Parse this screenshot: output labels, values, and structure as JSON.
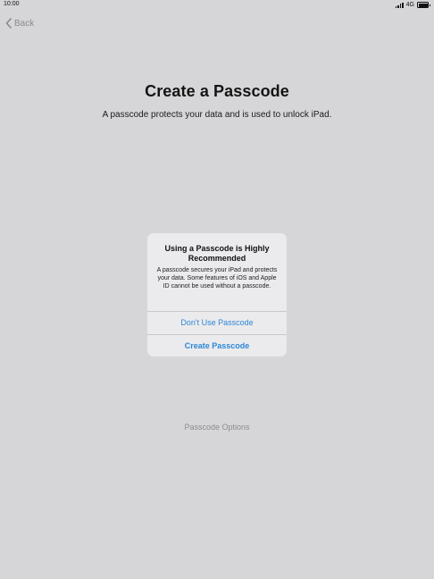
{
  "status_bar": {
    "time": "10:00",
    "network": "4G",
    "icons": [
      "signal-icon",
      "battery-icon"
    ]
  },
  "nav": {
    "back_label": "Back",
    "back_icon": "chevron-left-icon"
  },
  "header": {
    "title": "Create a Passcode",
    "subtitle": "A passcode protects your data and is used to unlock iPad."
  },
  "alert": {
    "title": "Using a Passcode is Highly Recommended",
    "message": "A passcode secures your iPad and protects your data. Some features of iOS and Apple ID cannot be used without a passcode.",
    "actions": [
      {
        "label": "Don't Use Passcode"
      },
      {
        "label": "Create Passcode"
      }
    ]
  },
  "footer": {
    "options_label": "Passcode Options"
  },
  "colors": {
    "background": "#d6d5d8",
    "alert_background": "#ebeaec",
    "accent": "#2d88d7",
    "muted_text": "#8d8c90"
  }
}
